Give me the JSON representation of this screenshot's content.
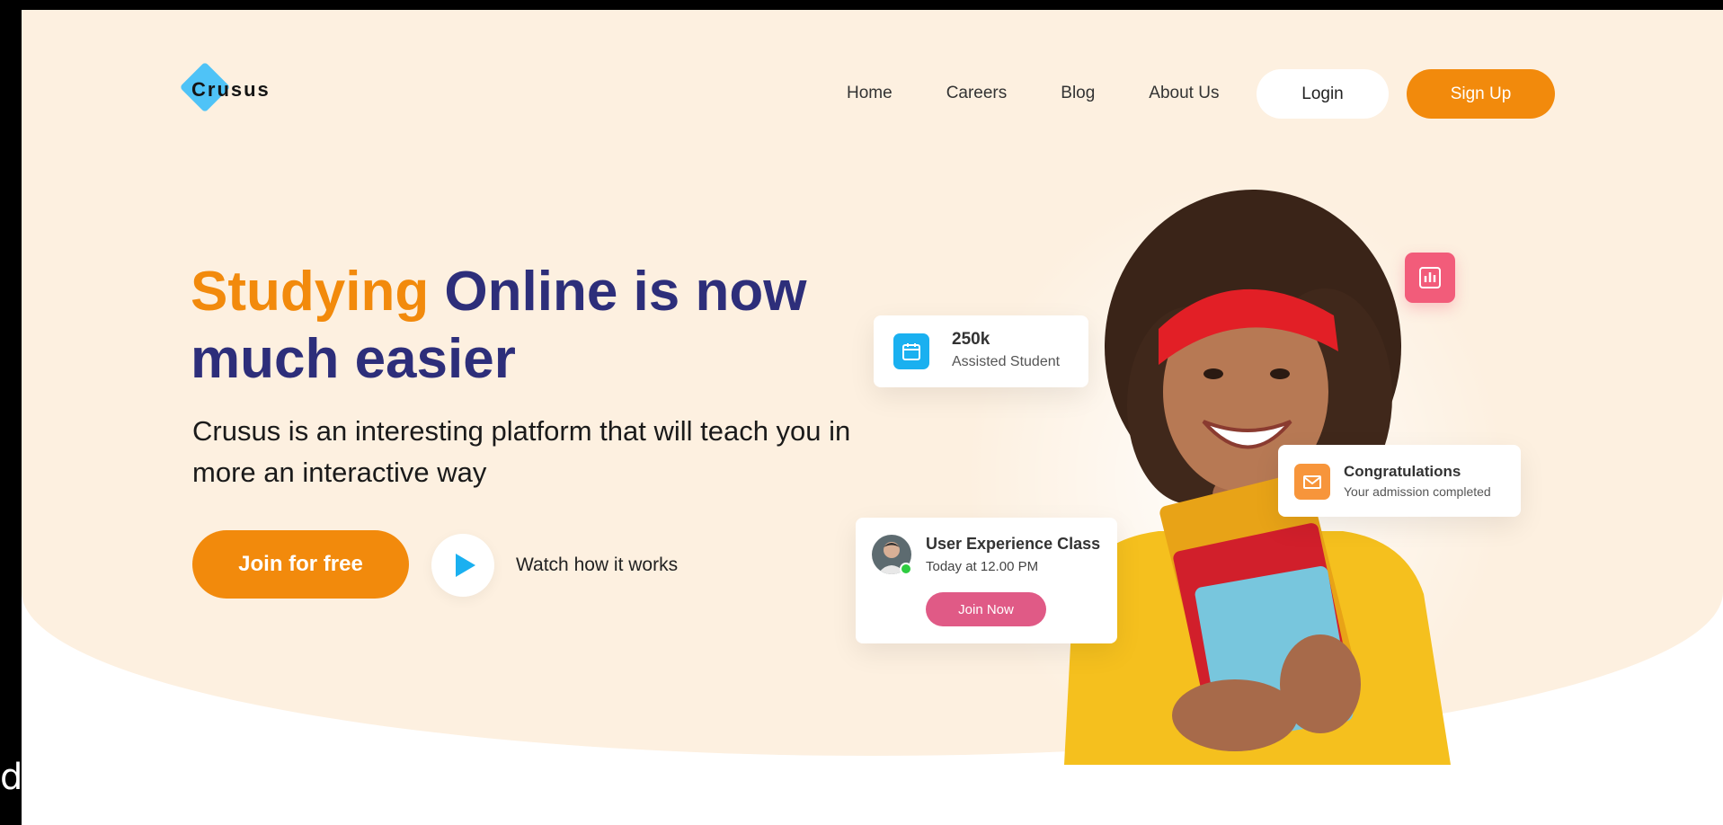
{
  "brand": {
    "name": "Crusus",
    "accent": "#f28a0c",
    "primary": "#2d2e7a",
    "diamond_color": "#4fc3f7"
  },
  "edge_text": "d",
  "nav": {
    "items": [
      {
        "label": "Home"
      },
      {
        "label": "Careers"
      },
      {
        "label": "Blog"
      },
      {
        "label": "About Us"
      }
    ],
    "login_label": "Login",
    "signup_label": "Sign Up"
  },
  "hero": {
    "headline_accent": "Studying",
    "headline_rest": " Online is now much easier",
    "subtext": "Crusus is an interesting platform that will teach you in more an interactive way",
    "join_label": "Join for free",
    "watch_label": "Watch how it works"
  },
  "cards": {
    "stat": {
      "value": "250k",
      "label": "Assisted Student",
      "icon": "calendar-icon"
    },
    "congrats": {
      "title": "Congratulations",
      "subtitle": "Your admission completed",
      "icon": "mail-icon"
    },
    "class": {
      "title": "User Experience Class",
      "time": "Today at 12.00 PM",
      "button_label": "Join Now"
    },
    "chart_badge": {
      "icon": "bar-chart-icon"
    }
  },
  "colors": {
    "hero_bg": "#fdf0e0",
    "blue_icon": "#1ab0f0",
    "orange_icon": "#f7953b",
    "pink": "#e05a86",
    "badge_pink": "#f25c7a",
    "online": "#2ecc40"
  }
}
